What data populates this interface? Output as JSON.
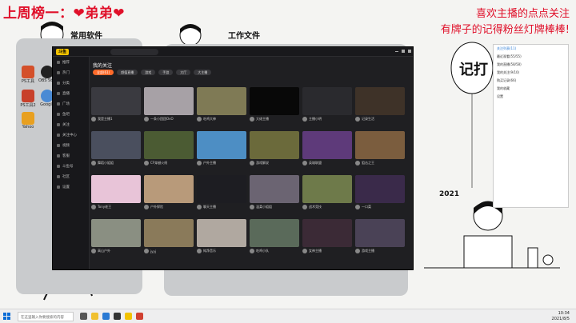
{
  "overlay": {
    "title": "上周榜一：❤弟弟❤",
    "line1": "喜欢主播的点点关注",
    "line2": "有牌子的记得粉丝灯牌棒棒!"
  },
  "desktop": {
    "folder1": "常用软件",
    "folder2": "工作文件",
    "year": "2021",
    "icons": [
      {
        "label": "PS工具"
      },
      {
        "label": "OBS Studio"
      },
      {
        "label": "PS工具2"
      },
      {
        "label": "Google"
      },
      {
        "label": "Yahoo"
      }
    ]
  },
  "app": {
    "logo": "斗鱼",
    "page_title": "我的关注",
    "chips": [
      "全部(61)",
      "颜值直播",
      "游戏",
      "手游",
      "大厅",
      "大主播"
    ],
    "sidebar": [
      "推荐",
      "热门",
      "分类",
      "直播",
      "广场",
      "鱼吧",
      "关注",
      "关注中心",
      "视频",
      "客服",
      "斗鱼号",
      "社区",
      "设置"
    ],
    "cards": [
      {
        "name": "我是主播1",
        "color": "#3a3a40"
      },
      {
        "name": "一条小团团OvO",
        "color": "#a7a1a6"
      },
      {
        "name": "吃鸡大神",
        "color": "#7f7a55"
      },
      {
        "name": "大佬主播",
        "color": "#080808"
      },
      {
        "name": "主播小明",
        "color": "#2a2a2e"
      },
      {
        "name": "记录生活",
        "color": "#3e3228"
      },
      {
        "name": "舞蹈小姐姐",
        "color": "#4a4f5e"
      },
      {
        "name": "CF穿越火线",
        "color": "#4b5b33"
      },
      {
        "name": "户外主播",
        "color": "#4d8ec4"
      },
      {
        "name": "游戏解说",
        "color": "#6b6a3b"
      },
      {
        "name": "英雄联盟",
        "color": "#5e3a7a"
      },
      {
        "name": "狙击之王",
        "color": "#7b5d3e"
      },
      {
        "name": "Tony老王",
        "color": "#e8c4d8"
      },
      {
        "name": "户外探险",
        "color": "#b89a7a"
      },
      {
        "name": "聊天主播",
        "color": "#1d1d22"
      },
      {
        "name": "温柔小姐姐",
        "color": "#6b6472"
      },
      {
        "name": "战术竞技",
        "color": "#6e7a4a"
      },
      {
        "name": "一口菜",
        "color": "#3a2a4a"
      },
      {
        "name": "高山户外",
        "color": "#8a8f82"
      },
      {
        "name": "jyyj",
        "color": "#8a7a5a"
      },
      {
        "name": "纯净音乐",
        "color": "#b0a8a0"
      },
      {
        "name": "吃鸡小队",
        "color": "#5a6a5a"
      },
      {
        "name": "女神主播",
        "color": "#3b2a36"
      },
      {
        "name": "游戏主播",
        "color": "#4a4256"
      }
    ]
  },
  "taskbar": {
    "search": "在这里输入你要搜索的内容",
    "time": "10:34",
    "date": "2021/8/5"
  },
  "panel": {
    "rows": [
      "关注列表(11)",
      "最近观看(55/55)",
      "我的直播(58/58)",
      "我的关注(9/10)",
      "购买记录(66)",
      "我的收藏",
      "设置"
    ]
  }
}
